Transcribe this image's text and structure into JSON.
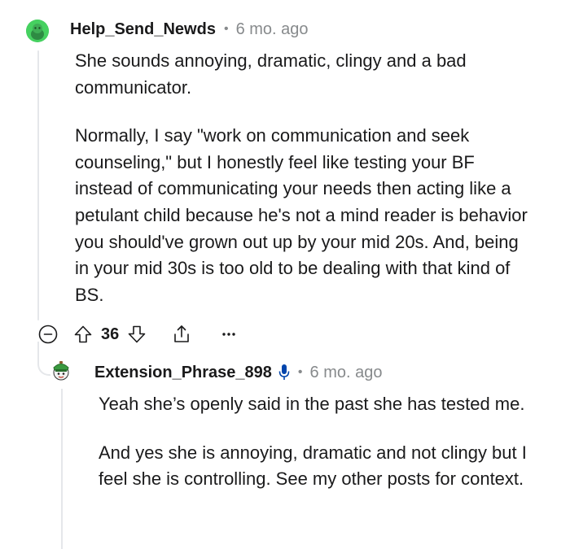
{
  "comment": {
    "username": "Help_Send_Newds",
    "separator": "•",
    "time": "6 mo. ago",
    "paragraphs": [
      "She sounds annoying, dramatic, clingy and a bad communicator.",
      "Normally, I say \"work on communication and seek counseling,\" but I honestly feel like testing your BF instead of communicating your needs then acting like a petulant child because he's not a mind reader is behavior you should've grown out up by your mid 20s. And, being in your mid 30s is too old to be dealing with that kind of BS."
    ],
    "score": "36",
    "icons": {
      "avatar": "snoo-avatar-icon",
      "collapse": "collapse-minus-icon",
      "upvote": "upvote-arrow-icon",
      "downvote": "downvote-arrow-icon",
      "share": "share-icon",
      "more": "more-options-icon"
    }
  },
  "reply": {
    "username": "Extension_Phrase_898",
    "separator": "•",
    "time": "6 mo. ago",
    "paragraphs": [
      "Yeah she’s openly said in the past she has tested me.",
      "And yes she is annoying, dramatic and not clingy but I feel she is controlling. See my other posts for context."
    ],
    "icons": {
      "avatar": "snoo-avatar-icon",
      "badge": "microphone-icon"
    }
  },
  "colors": {
    "text": "#1a1a1b",
    "meta": "#878a8c",
    "thread_line": "#e5e7ea",
    "avatar_green": "#46d160",
    "mic_blue": "#0045ac"
  }
}
